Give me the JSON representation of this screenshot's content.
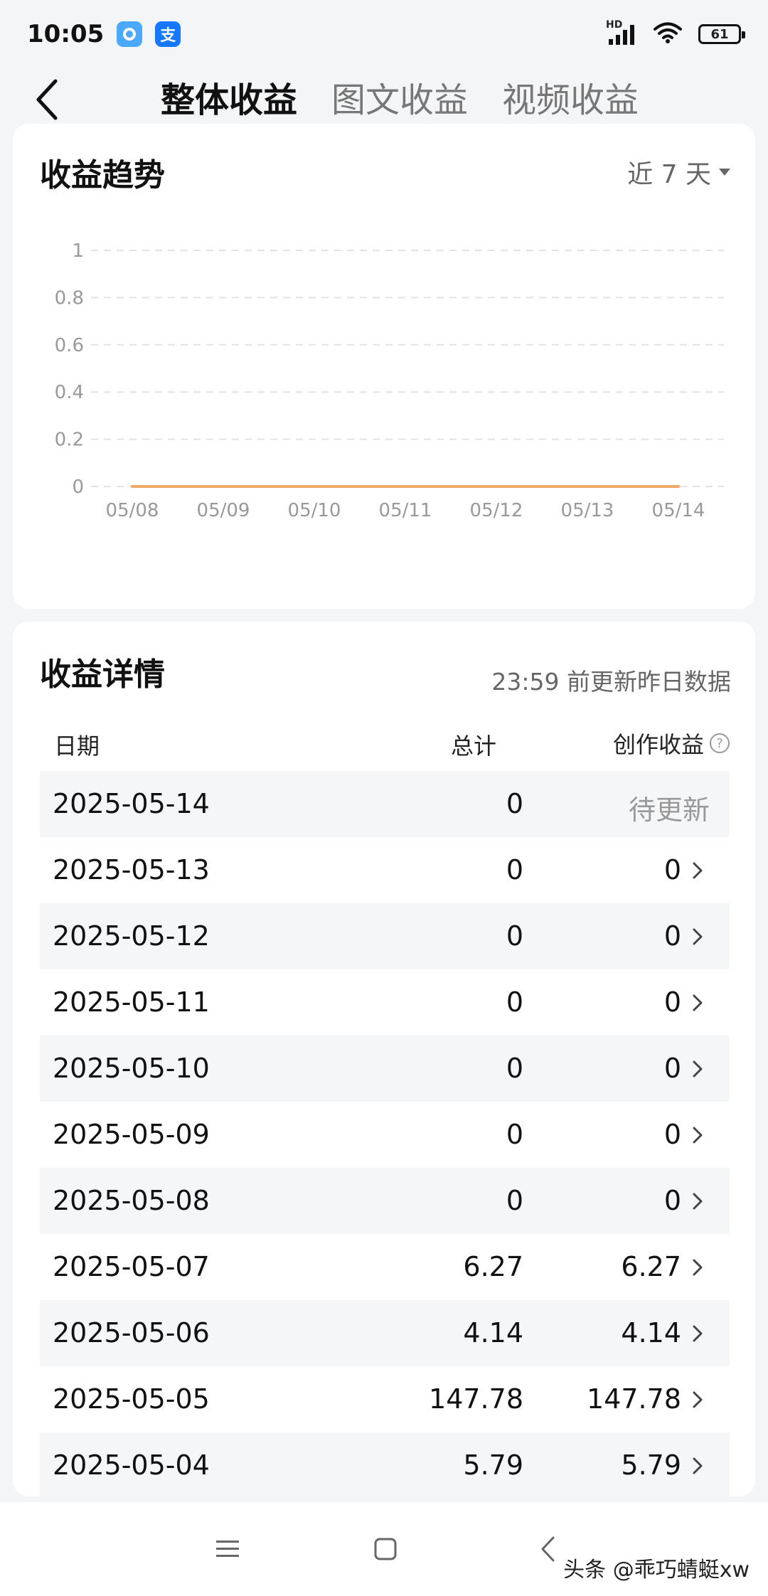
{
  "status_bar": {
    "time": "10:05",
    "app_badge_2": "支",
    "network": "HD",
    "battery": "61"
  },
  "header": {
    "tabs": [
      {
        "label": "整体收益",
        "active": true
      },
      {
        "label": "图文收益",
        "active": false
      },
      {
        "label": "视频收益",
        "active": false
      }
    ]
  },
  "trend": {
    "title": "收益趋势",
    "period": "近 7 天"
  },
  "chart_data": {
    "type": "line",
    "title": "收益趋势",
    "categories": [
      "05/08",
      "05/09",
      "05/10",
      "05/11",
      "05/12",
      "05/13",
      "05/14"
    ],
    "series": [
      {
        "values": [
          0,
          0,
          0,
          0,
          0,
          0,
          0
        ],
        "color": "#f0a868"
      }
    ],
    "y_ticks": [
      "1",
      "0.8",
      "0.6",
      "0.4",
      "0.2",
      "0"
    ],
    "ylim": [
      0,
      1
    ],
    "grid": "dashed horizontal"
  },
  "detail": {
    "title": "收益详情",
    "note": "23:59 前更新昨日数据",
    "columns": {
      "date": "日期",
      "total": "总计",
      "creation": "创作收益"
    },
    "rows": [
      {
        "date": "2025-05-14",
        "total": "0",
        "creation": "待更新",
        "pending": true
      },
      {
        "date": "2025-05-13",
        "total": "0",
        "creation": "0"
      },
      {
        "date": "2025-05-12",
        "total": "0",
        "creation": "0"
      },
      {
        "date": "2025-05-11",
        "total": "0",
        "creation": "0"
      },
      {
        "date": "2025-05-10",
        "total": "0",
        "creation": "0"
      },
      {
        "date": "2025-05-09",
        "total": "0",
        "creation": "0"
      },
      {
        "date": "2025-05-08",
        "total": "0",
        "creation": "0"
      },
      {
        "date": "2025-05-07",
        "total": "6.27",
        "creation": "6.27"
      },
      {
        "date": "2025-05-06",
        "total": "4.14",
        "creation": "4.14"
      },
      {
        "date": "2025-05-05",
        "total": "147.78",
        "creation": "147.78"
      },
      {
        "date": "2025-05-04",
        "total": "5.79",
        "creation": "5.79"
      }
    ]
  },
  "watermark": "头条 @乖巧蜻蜓xw",
  "colors": {
    "line": "#f0a868",
    "accent_blue": "#1677ff",
    "muted": "#999999"
  }
}
